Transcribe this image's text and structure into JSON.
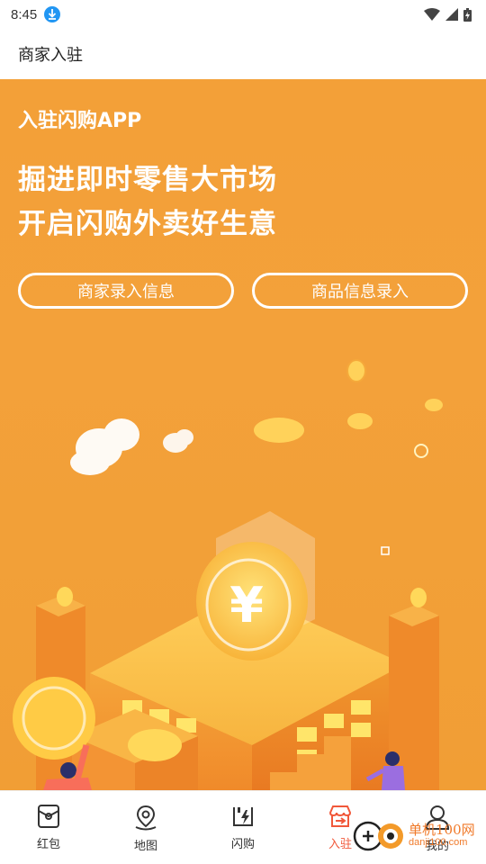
{
  "status": {
    "time": "8:45"
  },
  "header": {
    "title": "商家入驻"
  },
  "hero": {
    "subtitle": "入驻闪购APP",
    "headline_line1": "掘进即时零售大市场",
    "headline_line2": "开启闪购外卖好生意",
    "buttons": {
      "merchant_entry": "商家录入信息",
      "product_entry": "商品信息录入"
    }
  },
  "nav": {
    "items": [
      {
        "label": "红包",
        "icon": "red-packet-icon"
      },
      {
        "label": "地图",
        "icon": "map-pin-icon"
      },
      {
        "label": "闪购",
        "icon": "flash-buy-icon"
      },
      {
        "label": "入驻",
        "icon": "store-entry-icon"
      },
      {
        "label": "我的",
        "icon": "user-icon"
      }
    ],
    "active": "入驻"
  },
  "watermark": {
    "text": "单机100网",
    "url": "danji100.com"
  },
  "colors": {
    "accent": "#f3a038",
    "active_tab": "#f1583a"
  }
}
